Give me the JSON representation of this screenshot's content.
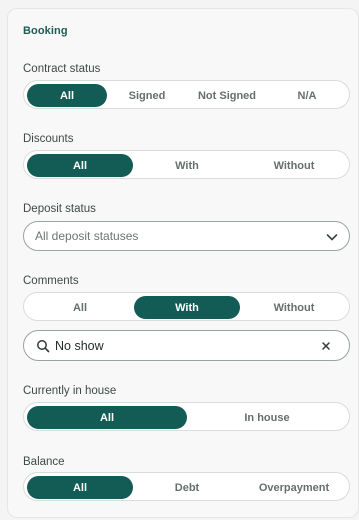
{
  "panel": {
    "title": "Booking"
  },
  "contract_status": {
    "label": "Contract status",
    "options": [
      "All",
      "Signed",
      "Not Signed",
      "N/A"
    ],
    "selected": "All"
  },
  "discounts": {
    "label": "Discounts",
    "options": [
      "All",
      "With",
      "Without"
    ],
    "selected": "All"
  },
  "deposit_status": {
    "label": "Deposit status",
    "placeholder": "All deposit statuses",
    "icon": "chevron-down-icon"
  },
  "comments": {
    "label": "Comments",
    "options": [
      "All",
      "With",
      "Without"
    ],
    "selected": "With",
    "search_value": "No show",
    "search_icon": "search-icon",
    "clear_icon": "close-icon"
  },
  "currently_in_house": {
    "label": "Currently in house",
    "options": [
      "All",
      "In house"
    ],
    "selected": "All"
  },
  "balance": {
    "label": "Balance",
    "options": [
      "All",
      "Debt",
      "Overpayment"
    ],
    "selected": "All"
  },
  "colors": {
    "accent": "#135b55",
    "title": "#235a55",
    "panel_bg": "#f7f8f7"
  }
}
